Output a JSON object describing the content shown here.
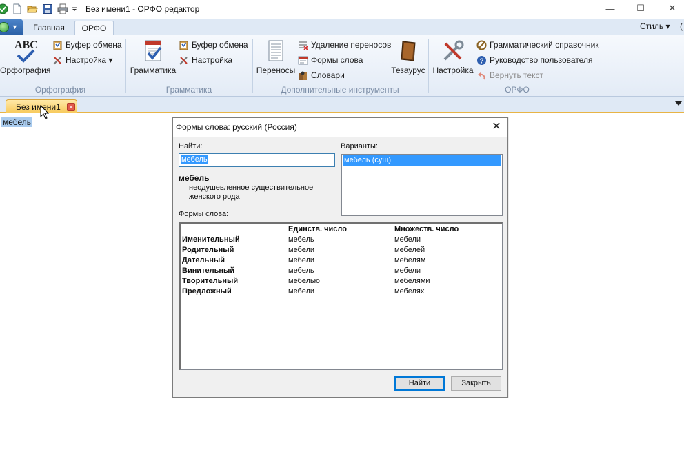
{
  "window": {
    "title": "Без имени1 - ОРФО редактор",
    "minimize": "—",
    "maximize": "☐",
    "close": "✕"
  },
  "ribbon_tabs": {
    "home": "Главная",
    "orfo": "ОРФО",
    "style_menu": "Стиль ▾",
    "help_marker": "("
  },
  "ribbon": {
    "groups": {
      "spelling": "Орфография",
      "grammar": "Грамматика",
      "tools": "Дополнительные инструменты",
      "orfo": "ОРФО"
    },
    "spelling": {
      "big_button": "Орфография",
      "clipboard": "Буфер обмена",
      "settings": "Настройка ▾",
      "abc_glyph": "ABC"
    },
    "grammar": {
      "big_button": "Грамматика",
      "clipboard": "Буфер обмена",
      "settings": "Настройка"
    },
    "tools": {
      "hyphens": "Переносы",
      "remove_hyphens": "Удаление переносов",
      "word_forms": "Формы слова",
      "dictionaries": "Словари",
      "thesaurus": "Тезаурус"
    },
    "orfo": {
      "settings": "Настройка",
      "grammar_reference": "Грамматический справочник",
      "user_guide": "Руководство пользователя",
      "revert_text": "Вернуть текст"
    }
  },
  "document": {
    "tab_label": "Без имени1",
    "tab_close": "×",
    "content_word": "мебель"
  },
  "dialog": {
    "title": "Формы слова: русский (Россия)",
    "close": "✕",
    "find_label": "Найти:",
    "find_value": "мебель",
    "variants_label": "Варианты:",
    "variants": [
      "мебель  (сущ)"
    ],
    "word": "мебель",
    "description": "неодушевленное существительное женского рода",
    "forms_label": "Формы слова:",
    "forms": {
      "headers": [
        "Единств. число",
        "Множеств. число"
      ],
      "rows": [
        {
          "case": "Именительный",
          "singular": "мебель",
          "plural": "мебели"
        },
        {
          "case": "Родительный",
          "singular": "мебели",
          "plural": "мебелей"
        },
        {
          "case": "Дательный",
          "singular": "мебели",
          "plural": "мебелям"
        },
        {
          "case": "Винительный",
          "singular": "мебель",
          "plural": "мебели"
        },
        {
          "case": "Творительный",
          "singular": "мебелью",
          "plural": "мебелями"
        },
        {
          "case": "Предложный",
          "singular": "мебели",
          "plural": "мебелях"
        }
      ]
    },
    "find_button": "Найти",
    "close_button": "Закрыть"
  },
  "colors": {
    "ribbon_bg": "#e3ebf6",
    "accent_blue": "#3399ff",
    "doc_tab": "#f7c95a",
    "group_label": "#7a8ca5"
  }
}
